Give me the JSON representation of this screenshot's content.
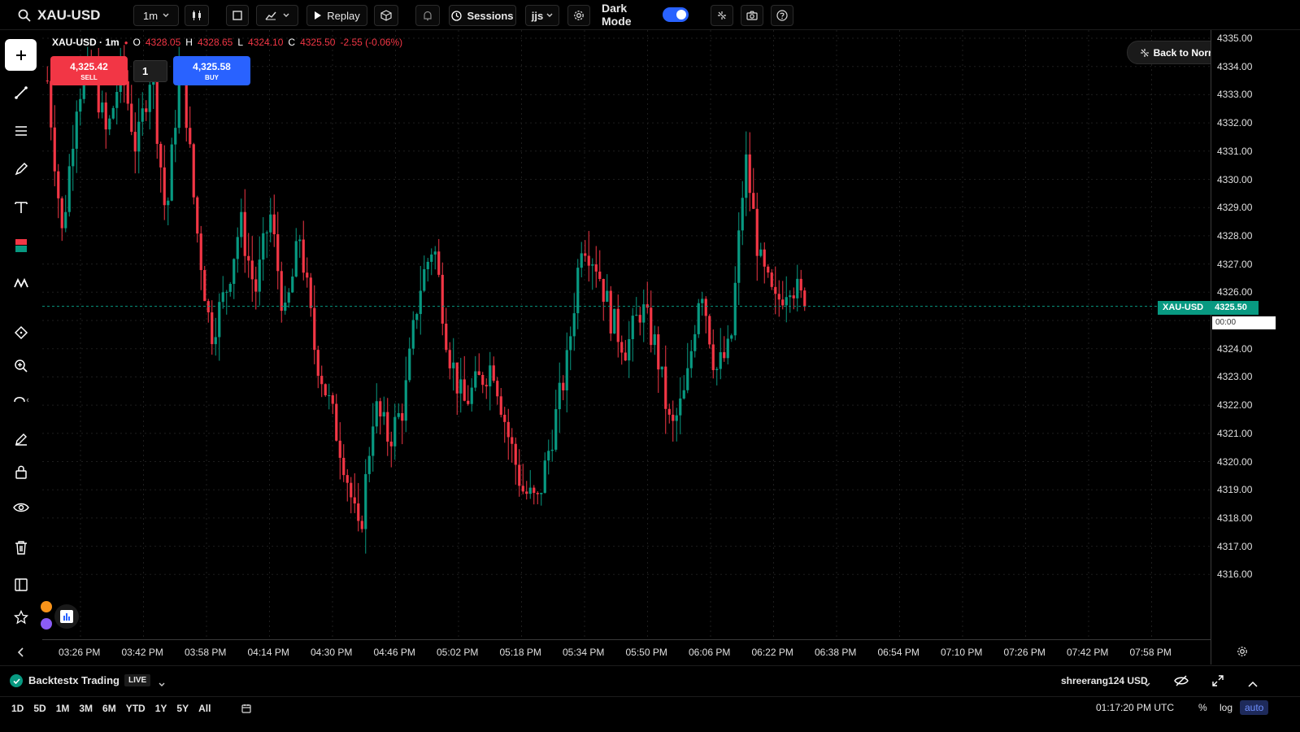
{
  "toolbar": {
    "symbol": "XAU-USD",
    "interval": "1m",
    "replay_label": "Replay",
    "sessions_label": "Sessions",
    "indicators_label": "jjs",
    "dark_mode_label": "Dark Mode",
    "dark_mode_on": true
  },
  "legend": {
    "symbol_interval": "XAU-USD · 1m",
    "open_label": "O",
    "open": "4328.05",
    "high_label": "H",
    "high": "4328.65",
    "low_label": "L",
    "low": "4324.10",
    "close_label": "C",
    "close": "4325.50",
    "change": "-2.55 (-0.06%)"
  },
  "trade": {
    "sell_price": "4,325.42",
    "sell_label": "SELL",
    "quantity": "1",
    "buy_price": "4,325.58",
    "buy_label": "BUY"
  },
  "back_to_normal_label": "Back to Normal Chart",
  "price_tag": {
    "symbol": "XAU-USD",
    "price": "4325.50",
    "countdown": "00:00"
  },
  "price_axis_labels": [
    "4335.00",
    "4334.00",
    "4333.00",
    "4332.00",
    "4331.00",
    "4330.00",
    "4329.00",
    "4328.00",
    "4327.00",
    "4326.00",
    "4324.00",
    "4323.00",
    "4322.00",
    "4321.00",
    "4320.00",
    "4319.00",
    "4318.00",
    "4317.00",
    "4316.00"
  ],
  "time_axis_labels": [
    "03:26 PM",
    "03:42 PM",
    "03:58 PM",
    "04:14 PM",
    "04:30 PM",
    "04:46 PM",
    "05:02 PM",
    "05:18 PM",
    "05:34 PM",
    "05:50 PM",
    "06:06 PM",
    "06:22 PM",
    "06:38 PM",
    "06:54 PM",
    "07:10 PM",
    "07:26 PM",
    "07:42 PM",
    "07:58 PM"
  ],
  "bottom": {
    "account_name": "Backtestx Trading",
    "live_badge": "LIVE",
    "user_account": "shreerang124 USD",
    "ranges": [
      "1D",
      "5D",
      "1M",
      "3M",
      "6M",
      "YTD",
      "1Y",
      "5Y",
      "All"
    ],
    "clock": "01:17:20 PM UTC",
    "percent_label": "%",
    "log_label": "log",
    "auto_label": "auto"
  },
  "colors": {
    "up": "#089981",
    "down": "#f23645",
    "accent": "#2962ff"
  },
  "chart_data": {
    "type": "candlestick",
    "symbol": "XAU-USD",
    "interval": "1m",
    "x": [
      "03:26 PM",
      "03:42 PM",
      "03:58 PM",
      "04:14 PM",
      "04:30 PM",
      "04:46 PM",
      "05:02 PM",
      "05:18 PM",
      "05:34 PM",
      "05:50 PM",
      "06:06 PM",
      "06:22 PM"
    ],
    "ylim": [
      4315.5,
      4335.0
    ],
    "last_price": 4325.5,
    "close_path": [
      4333.5,
      4328,
      4333,
      4334,
      4331.5,
      4334,
      4331,
      4334,
      4328.5,
      4334.5,
      4328.5,
      4324.5,
      4326,
      4328.5,
      4326,
      4328.8,
      4325,
      4328,
      4324,
      4322,
      4320,
      4317.2,
      4322,
      4320.8,
      4322,
      4326,
      4327.8,
      4324,
      4322,
      4322.8,
      4323.5,
      4321,
      4319,
      4318.5,
      4321,
      4323.5,
      4328,
      4327,
      4325,
      4324,
      4325.5,
      4324,
      4321,
      4322.5,
      4326.5,
      4323.2,
      4324,
      4330.8,
      4327,
      4325.5,
      4326.5,
      4325.5
    ]
  }
}
